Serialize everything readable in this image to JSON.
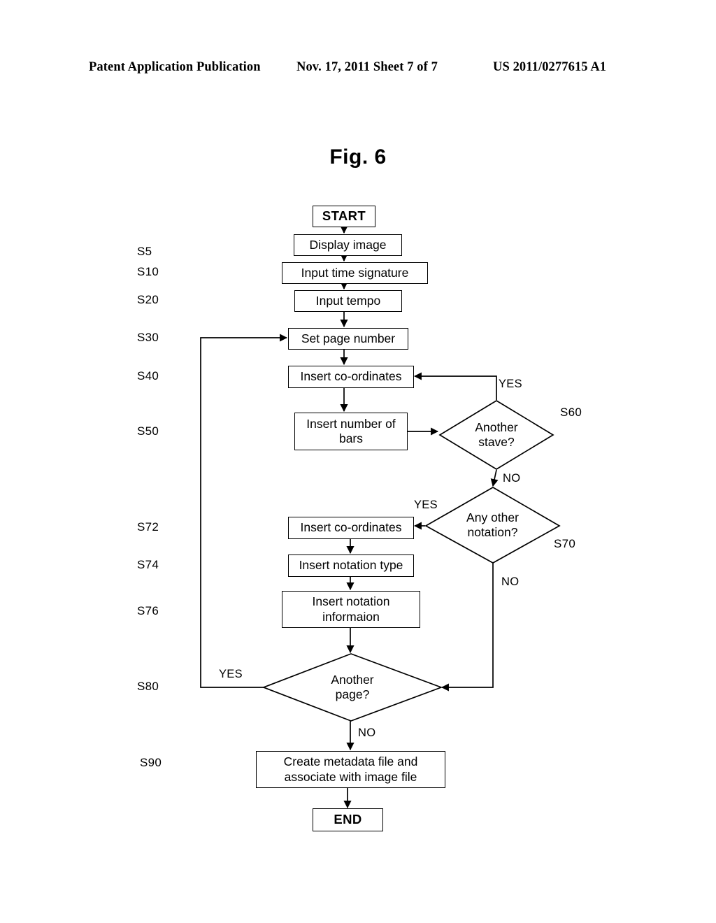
{
  "header": {
    "left": "Patent Application Publication",
    "center": "Nov. 17, 2011  Sheet 7 of 7",
    "right": "US 2011/0277615 A1"
  },
  "figure": {
    "title": "Fig. 6"
  },
  "flowchart": {
    "type": "flowchart",
    "nodes": [
      {
        "id": "start",
        "shape": "terminal",
        "label": "START"
      },
      {
        "id": "s5",
        "shape": "process",
        "label": "Display image"
      },
      {
        "id": "s10",
        "shape": "process",
        "label": "Input time signature"
      },
      {
        "id": "s20",
        "shape": "process",
        "label": "Input tempo"
      },
      {
        "id": "s30",
        "shape": "process",
        "label": "Set page number"
      },
      {
        "id": "s40",
        "shape": "process",
        "label": "Insert co-ordinates"
      },
      {
        "id": "s50",
        "shape": "process",
        "label": "Insert number of bars",
        "line1": "Insert number of",
        "line2": "bars"
      },
      {
        "id": "s60",
        "shape": "decision",
        "label": "Another stave?",
        "line1": "Another",
        "line2": "stave?"
      },
      {
        "id": "s70",
        "shape": "decision",
        "label": "Any other notation?",
        "line1": "Any other",
        "line2": "notation?"
      },
      {
        "id": "s72",
        "shape": "process",
        "label": "Insert co-ordinates"
      },
      {
        "id": "s74",
        "shape": "process",
        "label": "Insert notation type"
      },
      {
        "id": "s76",
        "shape": "process",
        "label": "Insert notation informaion",
        "line1": "Insert notation",
        "line2": "informaion"
      },
      {
        "id": "s80",
        "shape": "decision",
        "label": "Another page?",
        "line1": "Another",
        "line2": "page?"
      },
      {
        "id": "s90",
        "shape": "process",
        "label": "Create metadata file and associate with image file",
        "line1": "Create metadata file and",
        "line2": "associate with image file"
      },
      {
        "id": "end",
        "shape": "terminal",
        "label": "END"
      }
    ],
    "step_labels": [
      {
        "id": "s5",
        "text": "S5"
      },
      {
        "id": "s10",
        "text": "S10"
      },
      {
        "id": "s20",
        "text": "S20"
      },
      {
        "id": "s30",
        "text": "S30"
      },
      {
        "id": "s40",
        "text": "S40"
      },
      {
        "id": "s50",
        "text": "S50"
      },
      {
        "id": "s72",
        "text": "S72"
      },
      {
        "id": "s74",
        "text": "S74"
      },
      {
        "id": "s76",
        "text": "S76"
      },
      {
        "id": "s80",
        "text": "S80"
      },
      {
        "id": "s90",
        "text": "S90"
      }
    ],
    "ref_callouts": [
      {
        "id": "s60",
        "text": "S60"
      },
      {
        "id": "s70",
        "text": "S70"
      }
    ],
    "edge_labels": {
      "s60_yes": "YES",
      "s60_no": "NO",
      "s70_yes": "YES",
      "s70_no": "NO",
      "s80_yes": "YES",
      "s80_no": "NO"
    }
  },
  "colors": {
    "ink": "#000000",
    "paper": "#ffffff"
  }
}
